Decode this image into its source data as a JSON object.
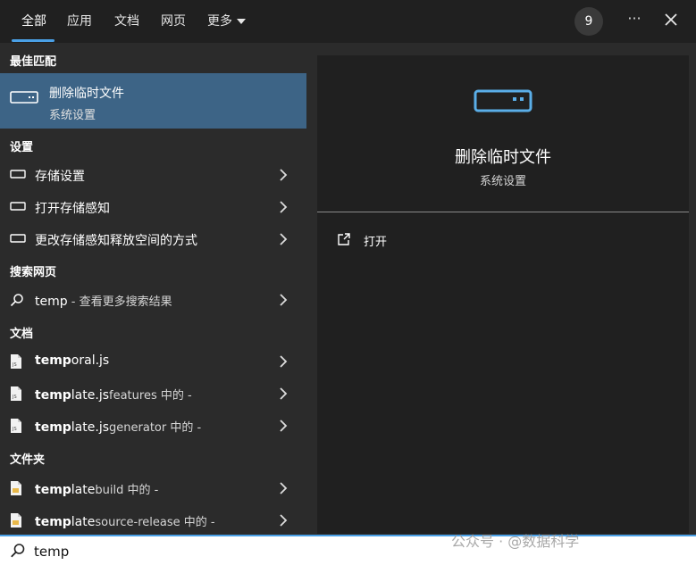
{
  "tabs": [
    {
      "label": "全部"
    },
    {
      "label": "应用"
    },
    {
      "label": "文档"
    },
    {
      "label": "网页"
    },
    {
      "label": "更多"
    }
  ],
  "header": {
    "badge": "9",
    "more": "···"
  },
  "best_match": {
    "heading": "最佳匹配",
    "title": "删除临时文件",
    "subtitle": "系统设置"
  },
  "settings": {
    "heading": "设置",
    "items": [
      {
        "label": "存储设置"
      },
      {
        "label": "打开存储感知"
      },
      {
        "label": "更改存储感知释放空间的方式"
      }
    ]
  },
  "web": {
    "heading": "搜索网页",
    "query": "temp",
    "hint": " - 查看更多搜索结果"
  },
  "docs": {
    "heading": "文档",
    "items": [
      {
        "bold": "temp",
        "rest": "oral.js",
        "hint": ""
      },
      {
        "bold": "temp",
        "rest": "late.js",
        "hint": "features 中的 -"
      },
      {
        "bold": "temp",
        "rest": "late.js",
        "hint": "generator 中的 -"
      }
    ]
  },
  "folders": {
    "heading": "文件夹",
    "items": [
      {
        "bold": "temp",
        "rest": "late",
        "hint": "build 中的 -"
      },
      {
        "bold": "temp",
        "rest": "late",
        "hint": "source-release 中的 -"
      }
    ]
  },
  "preview": {
    "title": "删除临时文件",
    "subtitle": "系统设置",
    "action": "打开"
  },
  "search": {
    "value": "temp"
  },
  "watermark": "公众号 · @数据科学"
}
